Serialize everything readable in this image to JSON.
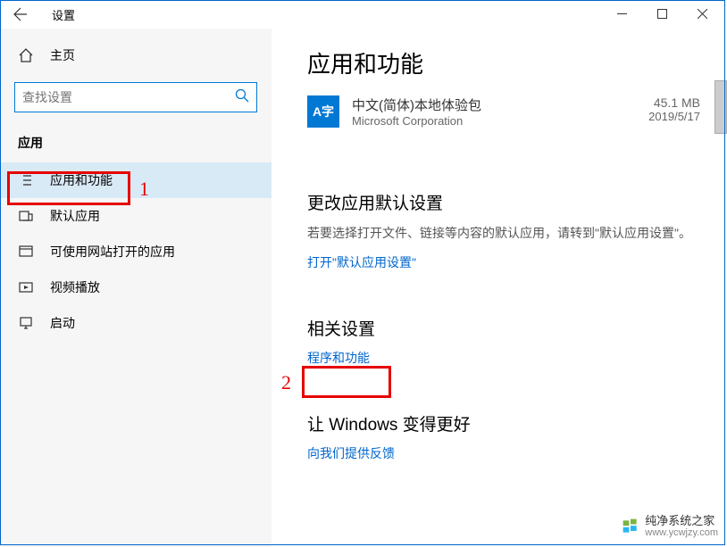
{
  "titlebar": {
    "title": "设置"
  },
  "sidebar": {
    "home": "主页",
    "search_placeholder": "查找设置",
    "category": "应用",
    "items": [
      {
        "label": "应用和功能"
      },
      {
        "label": "默认应用"
      },
      {
        "label": "可使用网站打开的应用"
      },
      {
        "label": "视频播放"
      },
      {
        "label": "启动"
      }
    ]
  },
  "main": {
    "title": "应用和功能",
    "app": {
      "name": "中文(简体)本地体验包",
      "vendor": "Microsoft Corporation",
      "size": "45.1 MB",
      "date": "2019/5/17",
      "icon_text": "A字"
    },
    "section_defaults": {
      "title": "更改应用默认设置",
      "desc": "若要选择打开文件、链接等内容的默认应用，请转到\"默认应用设置\"。",
      "link": "打开\"默认应用设置\""
    },
    "section_related": {
      "title": "相关设置",
      "link": "程序和功能"
    },
    "section_feedback": {
      "title": "让 Windows 变得更好",
      "link": "向我们提供反馈"
    }
  },
  "annotations": {
    "one": "1",
    "two": "2"
  },
  "watermark": {
    "name": "纯净系统之家",
    "url": "www.ycwjzy.com"
  }
}
